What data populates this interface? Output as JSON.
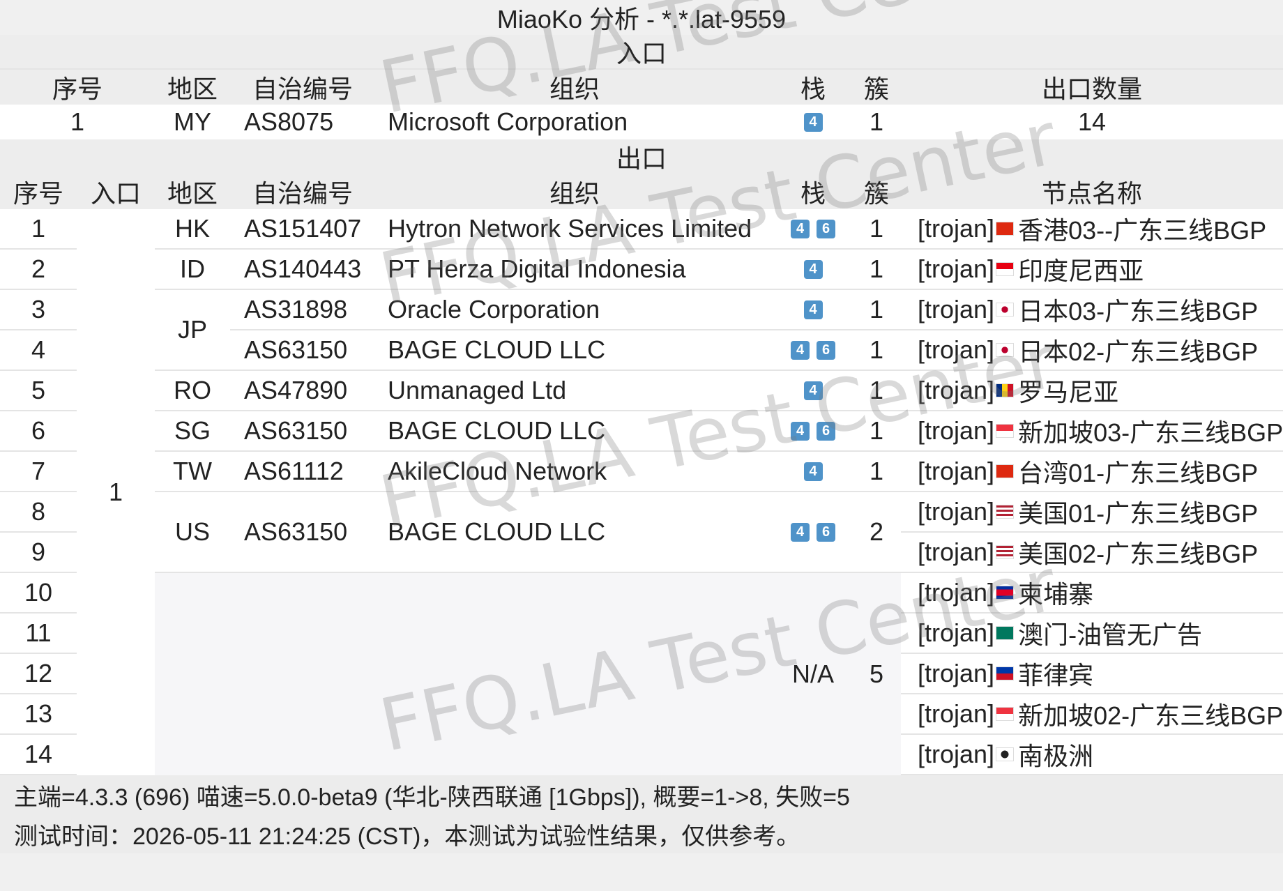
{
  "title": "MiaoKo 分析 - *.*.lat-9559",
  "entry": {
    "section_label": "入口",
    "headers": {
      "index": "序号",
      "region": "地区",
      "asn": "自治编号",
      "org": "组织",
      "stack": "栈",
      "cluster": "簇",
      "exit_count": "出口数量"
    },
    "row": {
      "index": "1",
      "region": "MY",
      "asn": "AS8075",
      "org": "Microsoft Corporation",
      "stack": [
        "4"
      ],
      "cluster": "1",
      "exit_count": "14"
    }
  },
  "exit": {
    "section_label": "出口",
    "headers": {
      "index": "序号",
      "entry": "入口",
      "region": "地区",
      "asn": "自治编号",
      "org": "组织",
      "stack": "栈",
      "cluster": "簇",
      "node": "节点名称"
    },
    "entry_value": "1",
    "groups": [
      {
        "region": "HK",
        "asn": "AS151407",
        "org": "Hytron Network Services Limited",
        "stack": [
          "4",
          "6"
        ],
        "cluster": "1"
      },
      {
        "region": "ID",
        "asn": "AS140443",
        "org": "PT Herza Digital Indonesia",
        "stack": [
          "4"
        ],
        "cluster": "1"
      },
      {
        "region": "JP",
        "asn": "AS31898",
        "org": "Oracle Corporation",
        "stack": [
          "4"
        ],
        "cluster": "1"
      },
      {
        "asn": "AS63150",
        "org": "BAGE CLOUD LLC",
        "stack": [
          "4",
          "6"
        ],
        "cluster": "1"
      },
      {
        "region": "RO",
        "asn": "AS47890",
        "org": "Unmanaged Ltd",
        "stack": [
          "4"
        ],
        "cluster": "1"
      },
      {
        "region": "SG",
        "asn": "AS63150",
        "org": "BAGE CLOUD LLC",
        "stack": [
          "4",
          "6"
        ],
        "cluster": "1"
      },
      {
        "region": "TW",
        "asn": "AS61112",
        "org": "AkileCloud Network",
        "stack": [
          "4"
        ],
        "cluster": "1"
      },
      {
        "region": "US",
        "asn": "AS63150",
        "org": "BAGE CLOUD LLC",
        "stack": [
          "4",
          "6"
        ],
        "cluster": "2"
      },
      {
        "stack_text": "N/A",
        "cluster": "5"
      }
    ],
    "rows": [
      {
        "index": "1",
        "prefix": "[trojan]",
        "flag": "hk",
        "name": "香港03--广东三线BGP"
      },
      {
        "index": "2",
        "prefix": "[trojan]",
        "flag": "id",
        "name": "印度尼西亚"
      },
      {
        "index": "3",
        "prefix": "[trojan]",
        "flag": "jp",
        "name": "日本03-广东三线BGP"
      },
      {
        "index": "4",
        "prefix": "[trojan]",
        "flag": "jp",
        "name": "日本02-广东三线BGP"
      },
      {
        "index": "5",
        "prefix": "[trojan]",
        "flag": "ro",
        "name": "罗马尼亚"
      },
      {
        "index": "6",
        "prefix": "[trojan]",
        "flag": "sg",
        "name": "新加坡03-广东三线BGP"
      },
      {
        "index": "7",
        "prefix": "[trojan]",
        "flag": "cn",
        "name": "台湾01-广东三线BGP"
      },
      {
        "index": "8",
        "prefix": "[trojan]",
        "flag": "us",
        "name": "美国01-广东三线BGP"
      },
      {
        "index": "9",
        "prefix": "[trojan]",
        "flag": "us",
        "name": "美国02-广东三线BGP"
      },
      {
        "index": "10",
        "prefix": "[trojan]",
        "flag": "kh",
        "name": "柬埔寨"
      },
      {
        "index": "11",
        "prefix": "[trojan]",
        "flag": "mo",
        "name": "澳门-油管无广告"
      },
      {
        "index": "12",
        "prefix": "[trojan]",
        "flag": "ph",
        "name": "菲律宾"
      },
      {
        "index": "13",
        "prefix": "[trojan]",
        "flag": "sg",
        "name": "新加坡02-广东三线BGP"
      },
      {
        "index": "14",
        "prefix": "[trojan]",
        "flag": "aq",
        "name": "南极洲"
      }
    ]
  },
  "footer": {
    "line1": "主端=4.3.3 (696) 喵速=5.0.0-beta9 (华北-陕西联通 [1Gbps]), 概要=1->8, 失败=5",
    "line2": "测试时间：2026-05-11 21:24:25 (CST)，本测试为试验性结果，仅供参考。"
  },
  "watermark": "FFQ.LA Test Center",
  "colors": {
    "badge": "#4f93c9",
    "header_bg": "#ededed",
    "row_bg": "#ffffff"
  }
}
